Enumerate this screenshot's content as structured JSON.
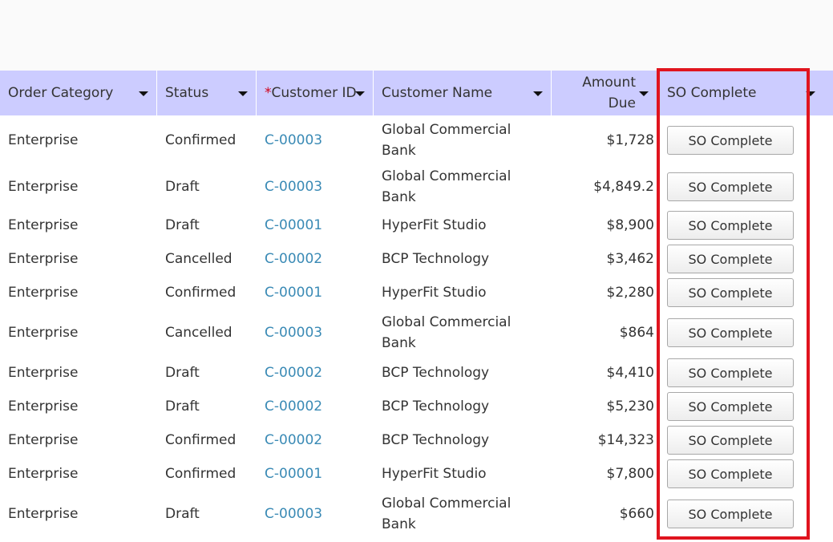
{
  "table": {
    "columns": [
      {
        "label": "Order Category"
      },
      {
        "label": "Status"
      },
      {
        "label": "Customer ID",
        "required_marker": "*"
      },
      {
        "label": "Customer Name"
      },
      {
        "label": "Amount Due"
      },
      {
        "label": "SO Complete"
      }
    ],
    "rows": [
      {
        "category": "Enterprise",
        "status": "Confirmed",
        "customer_id": "C-00003",
        "customer_name": "Global Commercial Bank",
        "amount": "$1,728",
        "action": "SO Complete"
      },
      {
        "category": "Enterprise",
        "status": "Draft",
        "customer_id": "C-00003",
        "customer_name": "Global Commercial Bank",
        "amount": "$4,849.2",
        "action": "SO Complete"
      },
      {
        "category": "Enterprise",
        "status": "Draft",
        "customer_id": "C-00001",
        "customer_name": "HyperFit Studio",
        "amount": "$8,900",
        "action": "SO Complete"
      },
      {
        "category": "Enterprise",
        "status": "Cancelled",
        "customer_id": "C-00002",
        "customer_name": "BCP Technology",
        "amount": "$3,462",
        "action": "SO Complete"
      },
      {
        "category": "Enterprise",
        "status": "Confirmed",
        "customer_id": "C-00001",
        "customer_name": "HyperFit Studio",
        "amount": "$2,280",
        "action": "SO Complete"
      },
      {
        "category": "Enterprise",
        "status": "Cancelled",
        "customer_id": "C-00003",
        "customer_name": "Global Commercial Bank",
        "amount": "$864",
        "action": "SO Complete"
      },
      {
        "category": "Enterprise",
        "status": "Draft",
        "customer_id": "C-00002",
        "customer_name": "BCP Technology",
        "amount": "$4,410",
        "action": "SO Complete"
      },
      {
        "category": "Enterprise",
        "status": "Draft",
        "customer_id": "C-00002",
        "customer_name": "BCP Technology",
        "amount": "$5,230",
        "action": "SO Complete"
      },
      {
        "category": "Enterprise",
        "status": "Confirmed",
        "customer_id": "C-00002",
        "customer_name": "BCP Technology",
        "amount": "$14,323",
        "action": "SO Complete"
      },
      {
        "category": "Enterprise",
        "status": "Confirmed",
        "customer_id": "C-00001",
        "customer_name": "HyperFit Studio",
        "amount": "$7,800",
        "action": "SO Complete"
      },
      {
        "category": "Enterprise",
        "status": "Draft",
        "customer_id": "C-00003",
        "customer_name": "Global Commercial Bank",
        "amount": "$660",
        "action": "SO Complete"
      }
    ]
  },
  "icons": {
    "sort": "caret-down-icon"
  },
  "colors": {
    "header_bg": "#ccccff",
    "link": "#3a8ab5",
    "highlight": "#e0141e",
    "required": "#d0021b"
  }
}
